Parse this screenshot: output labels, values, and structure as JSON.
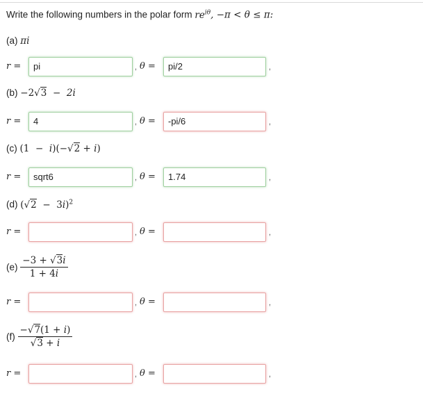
{
  "intro": {
    "text": "Write the following numbers in the polar form",
    "form": "re",
    "form_sup": "iθ",
    "condition": ", −π < θ ≤ π:"
  },
  "parts": [
    {
      "label": "(a)",
      "r_value": "pi",
      "theta_value": "pi/2",
      "r_status": "correct",
      "theta_status": "correct"
    },
    {
      "label": "(b)",
      "r_value": "4",
      "theta_value": "-pi/6",
      "r_status": "correct",
      "theta_status": "incorrect"
    },
    {
      "label": "(c)",
      "r_value": "sqrt6",
      "theta_value": "1.74",
      "r_status": "correct",
      "theta_status": "correct"
    },
    {
      "label": "(d)",
      "r_value": "",
      "theta_value": "",
      "r_status": "incorrect",
      "theta_status": "incorrect"
    },
    {
      "label": "(e)",
      "r_value": "",
      "theta_value": "",
      "r_status": "incorrect",
      "theta_status": "incorrect"
    },
    {
      "label": "(f)",
      "r_value": "",
      "theta_value": "",
      "r_status": "incorrect",
      "theta_status": "incorrect"
    }
  ],
  "symbols": {
    "r_eq": "r =",
    "theta_eq": "θ =",
    "comma": ","
  }
}
